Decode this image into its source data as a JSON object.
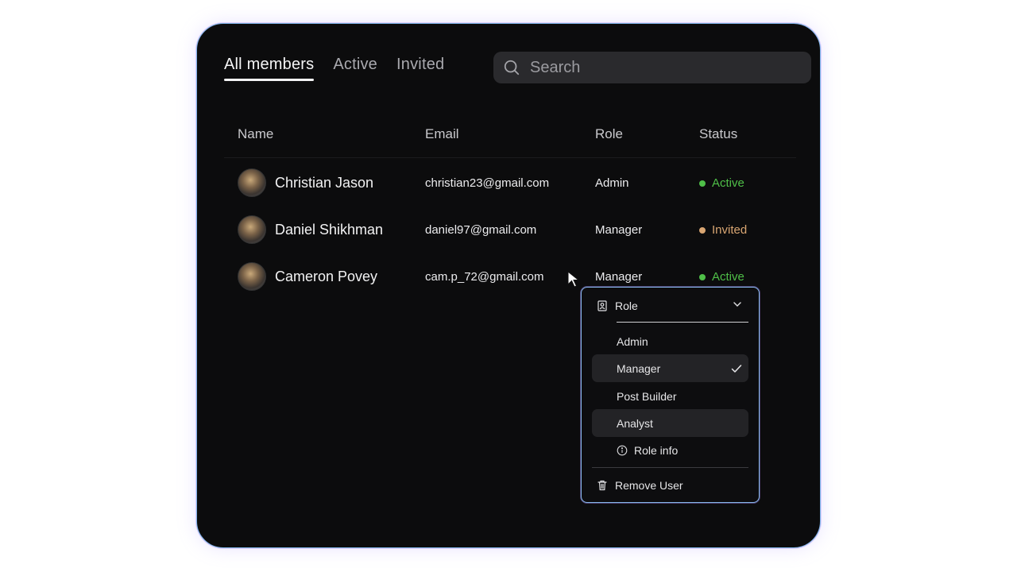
{
  "tabs": [
    {
      "label": "All members",
      "active": true
    },
    {
      "label": "Active",
      "active": false
    },
    {
      "label": "Invited",
      "active": false
    }
  ],
  "search": {
    "placeholder": "Search",
    "icon": "search-icon"
  },
  "table": {
    "columns": [
      "Name",
      "Email",
      "Role",
      "Status"
    ],
    "rows": [
      {
        "name": "Christian Jason",
        "email": "christian23@gmail.com",
        "role": "Admin",
        "status": "Active"
      },
      {
        "name": "Daniel Shikhman",
        "email": "daniel97@gmail.com",
        "role": "Manager",
        "status": "Invited"
      },
      {
        "name": "Cameron Povey",
        "email": "cam.p_72@gmail.com",
        "role": "Manager",
        "status": "Active"
      }
    ]
  },
  "menu": {
    "header": "Role",
    "options": [
      "Admin",
      "Manager",
      "Post Builder",
      "Analyst"
    ],
    "selected": "Manager",
    "hovered": "Analyst",
    "info_label": "Role info",
    "remove_label": "Remove User"
  },
  "colors": {
    "background": "#0c0c0d",
    "active_status": "#4fbf48",
    "invited_status": "#d9a672",
    "border_accent": "#86b8ec"
  }
}
